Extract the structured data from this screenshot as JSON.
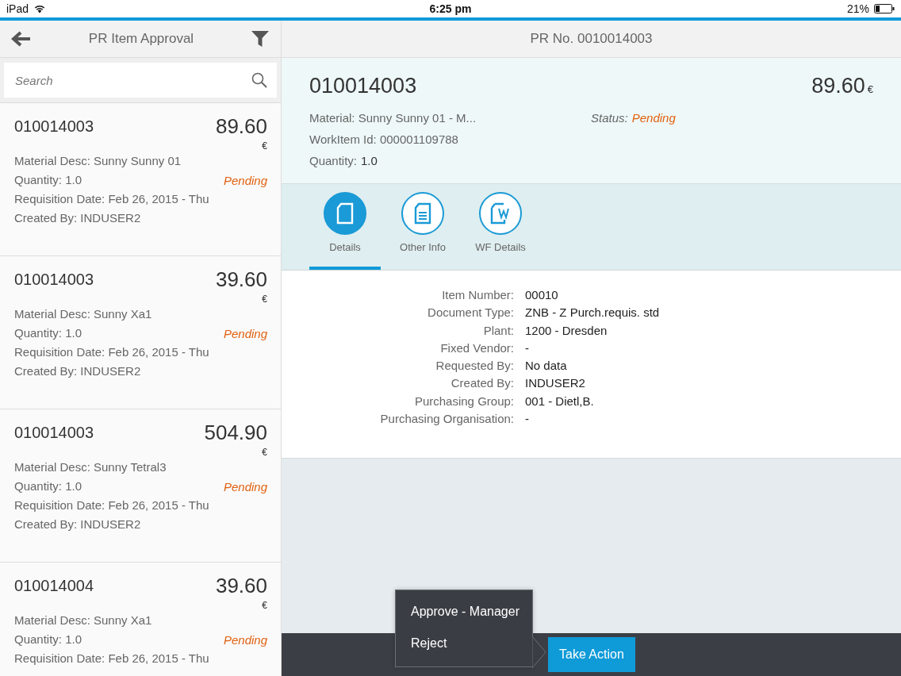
{
  "status_bar": {
    "device": "iPad",
    "time": "6:25 pm",
    "battery": "21%"
  },
  "master": {
    "title": "PR Item Approval",
    "search": {
      "placeholder": "Search"
    },
    "items": [
      {
        "number": "010014003",
        "amount": "89.60",
        "currency": "€",
        "material": "Material Desc: Sunny Sunny 01",
        "quantity": "Quantity: 1.0",
        "status": "Pending",
        "date": "Requisition Date: Feb 26, 2015 - Thu",
        "created": "Created By: INDUSER2"
      },
      {
        "number": "010014003",
        "amount": "39.60",
        "currency": "€",
        "material": "Material Desc: Sunny Xa1",
        "quantity": "Quantity: 1.0",
        "status": "Pending",
        "date": "Requisition Date: Feb 26, 2015 - Thu",
        "created": "Created By: INDUSER2"
      },
      {
        "number": "010014003",
        "amount": "504.90",
        "currency": "€",
        "material": "Material Desc: Sunny Tetral3",
        "quantity": "Quantity: 1.0",
        "status": "Pending",
        "date": "Requisition Date: Feb 26, 2015 - Thu",
        "created": "Created By: INDUSER2"
      },
      {
        "number": "010014004",
        "amount": "39.60",
        "currency": "€",
        "material": "Material Desc: Sunny Xa1",
        "quantity": "Quantity: 1.0",
        "status": "Pending",
        "date": "Requisition Date: Feb 26, 2015 - Thu"
      }
    ]
  },
  "detail": {
    "title": "PR No. 0010014003",
    "header": {
      "number": "010014003",
      "amount": "89.60",
      "currency": "€",
      "material": "Material: Sunny Sunny 01 - M...",
      "workitem": "WorkItem Id: 000001109788",
      "quantity_label": "Quantity:",
      "quantity": "1.0",
      "status_label": "Status:",
      "status": "Pending"
    },
    "tabs": [
      {
        "label": "Details",
        "kind": "page",
        "selected": true
      },
      {
        "label": "Other Info",
        "kind": "lines",
        "selected": false
      },
      {
        "label": "WF Details",
        "kind": "workflow",
        "selected": false
      }
    ],
    "fields": [
      {
        "label": "Item Number:",
        "value": "00010"
      },
      {
        "label": "Document Type:",
        "value": "ZNB - Z Purch.requis. std"
      },
      {
        "label": "Plant:",
        "value": "1200 - Dresden"
      },
      {
        "label": "Fixed Vendor:",
        "value": "-"
      },
      {
        "label": "Requested By:",
        "value": "No data"
      },
      {
        "label": "Created By:",
        "value": "INDUSER2"
      },
      {
        "label": "Purchasing Group:",
        "value": "001 - Dietl,B."
      },
      {
        "label": "Purchasing Organisation:",
        "value": "-"
      }
    ]
  },
  "action_menu": [
    "Approve - Manager",
    "Reject"
  ],
  "footer": {
    "button": "Take Action"
  }
}
